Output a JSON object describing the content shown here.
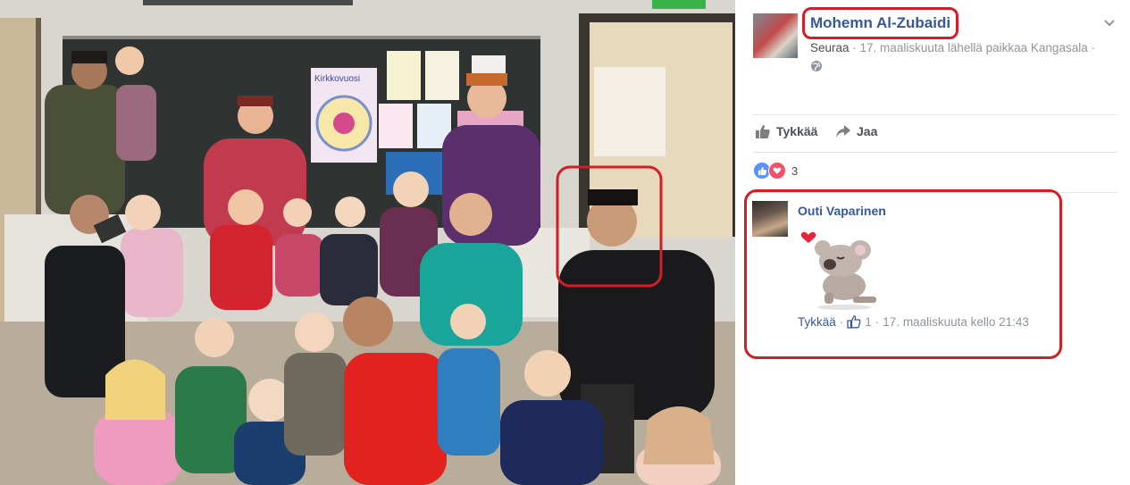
{
  "photo": {
    "board_poster_label": "Kirkkovuosi"
  },
  "post": {
    "author_name": "Mohemn Al-Zubaidi",
    "follow_label": "Seuraa",
    "meta_rest": " · 17. maaliskuuta lähellä paikkaa Kangasala ·",
    "privacy_icon": "globe-icon",
    "options_icon": "chevron-down-icon"
  },
  "actions": {
    "like_label": "Tykkää",
    "share_label": "Jaa"
  },
  "reactions": {
    "types": [
      "like",
      "love"
    ],
    "count": "3"
  },
  "comment": {
    "author_name": "Outi Vaparinen",
    "sticker": "koala-heart-sticker",
    "like_label": "Tykkää",
    "separator": "·",
    "like_count": "1",
    "timestamp": "17. maaliskuuta kello 21:43"
  },
  "colors": {
    "link": "#365899",
    "highlight_ring": "#d11f25",
    "like_blue": "#5890ff",
    "love_red": "#f25268"
  }
}
